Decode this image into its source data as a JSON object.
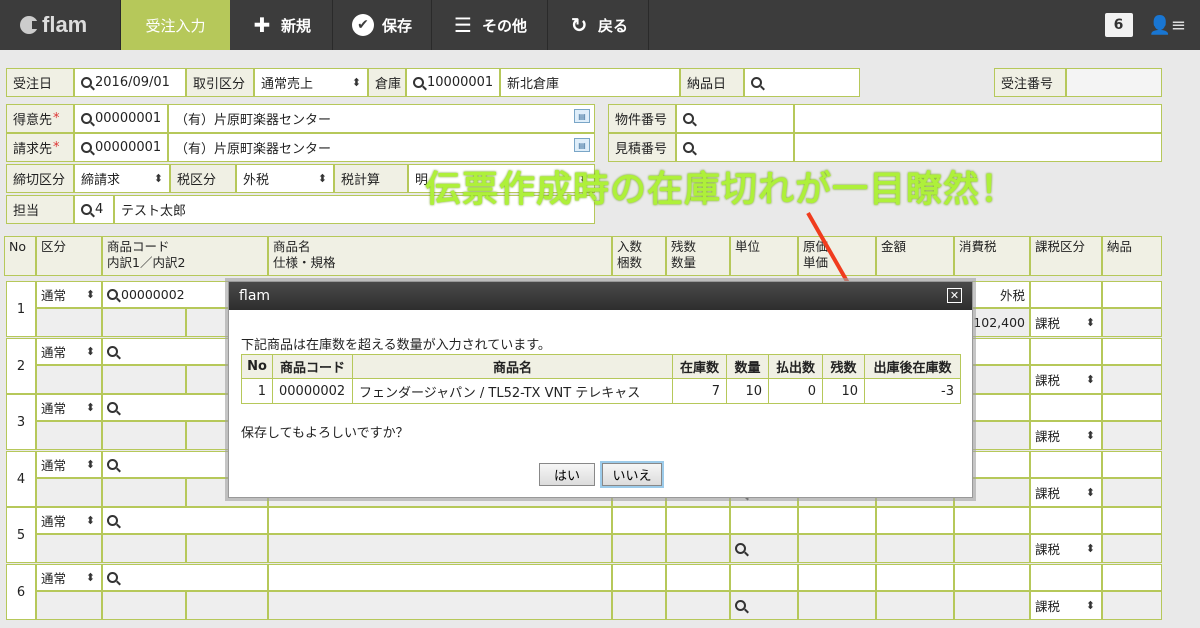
{
  "app": {
    "logo": "flam"
  },
  "toolbar": {
    "active_tab": "受注入力",
    "new_label": "新規",
    "save_label": "保存",
    "other_label": "その他",
    "back_label": "戻る",
    "notification_count": "6"
  },
  "header": {
    "order_date_label": "受注日",
    "order_date": "2016/09/01",
    "trade_type_label": "取引区分",
    "trade_type": "通常売上",
    "warehouse_label": "倉庫",
    "warehouse_code": "10000001",
    "warehouse_name": "新北倉庫",
    "delivery_date_label": "納品日",
    "order_no_label": "受注番号",
    "customer_label": "得意先",
    "customer_code": "00000001",
    "customer_name": "（有）片原町楽器センター",
    "billing_label": "請求先",
    "billing_code": "00000001",
    "billing_name": "（有）片原町楽器センター",
    "property_no_label": "物件番号",
    "estimate_no_label": "見積番号",
    "closing_label": "締切区分",
    "closing_value": "締請求",
    "tax_type_label": "税区分",
    "tax_type_value": "外税",
    "tax_calc_label": "税計算",
    "tax_calc_value_partial": "明",
    "person_label": "担当",
    "person_code": "4",
    "person_name": "テスト太郎",
    "required_mark": "*"
  },
  "grid": {
    "headers": {
      "no": "No",
      "kubun": "区分",
      "code": "商品コード",
      "code_sub": "内訳1／内訳2",
      "name": "商品名",
      "name_sub": "仕様・規格",
      "irisu": "入数",
      "irisu_sub": "梱数",
      "zansu": "残数",
      "zansu_sub": "数量",
      "unit": "単位",
      "genka": "原価",
      "genka_sub": "単価",
      "amount": "金額",
      "tax": "消費税",
      "tax_kubun": "課税区分",
      "nouhin": "納品"
    },
    "rows": [
      {
        "no": "1",
        "kubun": "通常",
        "code": "00000002",
        "tax_label": "外税",
        "amount": "102,400",
        "tax_kubun": "課税"
      },
      {
        "no": "2",
        "kubun": "通常",
        "code": "",
        "tax_kubun": "課税"
      },
      {
        "no": "3",
        "kubun": "通常",
        "code": "",
        "tax_kubun": "課税"
      },
      {
        "no": "4",
        "kubun": "通常",
        "code": "",
        "tax_kubun": "課税"
      },
      {
        "no": "5",
        "kubun": "通常",
        "code": "",
        "tax_kubun": "課税"
      },
      {
        "no": "6",
        "kubun": "通常",
        "code": "",
        "tax_kubun": "課税"
      }
    ]
  },
  "dialog": {
    "title": "flam",
    "message": "下記商品は在庫数を超える数量が入力されています。",
    "columns": [
      "No",
      "商品コード",
      "商品名",
      "在庫数",
      "数量",
      "払出数",
      "残数",
      "出庫後在庫数"
    ],
    "rows": [
      {
        "no": "1",
        "code": "00000002",
        "name": "フェンダージャパン / TL52-TX VNT テレキャス",
        "stock": "7",
        "qty": "10",
        "issued": "0",
        "remaining": "10",
        "after": "-3"
      }
    ],
    "confirm": "保存してもよろしいですか？",
    "yes_label": "はい",
    "no_label": "いいえ"
  },
  "annotation": {
    "text": "伝票作成時の在庫切れが一目瞭然！",
    "color": "#aef03a",
    "arrow_color": "#f03c1e"
  },
  "colors": {
    "accent": "#b6c85a",
    "topbar": "#3c3c3c",
    "label_bg": "#f0f0e4"
  }
}
